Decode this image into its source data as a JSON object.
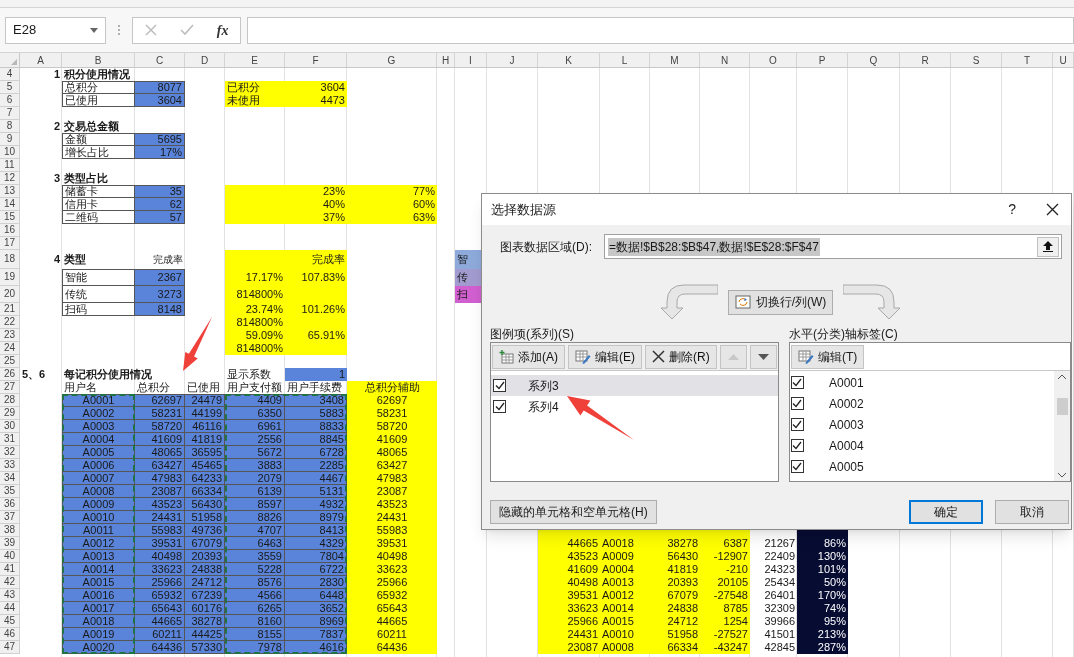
{
  "name_box": {
    "value": "E28"
  },
  "formula_bar": {
    "buttons": [
      {
        "kind": "cancel",
        "disabled": true
      },
      {
        "kind": "enter",
        "disabled": true
      },
      {
        "kind": "function",
        "label": "fx",
        "disabled": false
      }
    ]
  },
  "columns": [
    "A",
    "B",
    "C",
    "D",
    "E",
    "F",
    "G",
    "H",
    "I",
    "J",
    "K",
    "L",
    "M",
    "N",
    "O",
    "P",
    "Q",
    "R",
    "S",
    "T",
    "U"
  ],
  "rows": [
    {
      "header": "4",
      "cells": [
        "1",
        "积分使用情况"
      ]
    },
    {
      "header": "5",
      "cells": [
        null,
        "总积分",
        "8077",
        null,
        "已积分",
        "3604"
      ]
    },
    {
      "header": "6",
      "cells": [
        null,
        "已使用",
        "3604",
        null,
        "未使用",
        "4473"
      ]
    },
    {
      "header": "7"
    },
    {
      "header": "8",
      "cells": [
        "2",
        "交易总金额"
      ]
    },
    {
      "header": "9",
      "cells": [
        null,
        "金额",
        "5695"
      ]
    },
    {
      "header": "10",
      "cells": [
        null,
        "增长占比",
        "17%"
      ]
    },
    {
      "header": "11"
    },
    {
      "header": "12",
      "cells": [
        "3",
        "类型占比"
      ]
    },
    {
      "header": "13",
      "cells": [
        null,
        "储蓄卡",
        "35",
        null,
        null,
        "23%",
        "77%"
      ]
    },
    {
      "header": "14",
      "cells": [
        null,
        "信用卡",
        "62",
        null,
        null,
        "40%",
        "60%"
      ]
    },
    {
      "header": "15",
      "cells": [
        null,
        "二维码",
        "57",
        null,
        null,
        "37%",
        "63%"
      ]
    },
    {
      "header": "16"
    },
    {
      "header": "17"
    },
    {
      "header": "18",
      "cells": [
        "4",
        "类型",
        "完成率",
        null,
        null,
        "完成率",
        null,
        null,
        {
          "text": "智",
          "color": "#8eaadb"
        }
      ]
    },
    {
      "header": "19",
      "cells": [
        null,
        "智能",
        "2367",
        null,
        "17.17%",
        "107.83%",
        null,
        null,
        {
          "text": "传",
          "color": "#a29bcf"
        }
      ]
    },
    {
      "header": "20",
      "cells": [
        null,
        "传统",
        "3273",
        null,
        "814800%",
        null,
        null,
        null,
        {
          "text": "扫",
          "color": "#d25fd0"
        }
      ]
    },
    {
      "header": "21",
      "cells": [
        null,
        "扫码",
        "8148",
        null,
        "23.74%",
        "101.26%"
      ]
    },
    {
      "header": "22",
      "cells": [
        null,
        null,
        null,
        null,
        "814800%"
      ]
    },
    {
      "header": "23",
      "cells": [
        null,
        null,
        null,
        null,
        "59.09%",
        "65.91%"
      ]
    },
    {
      "header": "24",
      "cells": [
        null,
        null,
        null,
        null,
        "814800%"
      ]
    },
    {
      "header": "25"
    },
    {
      "header": "26",
      "cells": [
        "5、6",
        "每记积分使用情况",
        null,
        null,
        "显示系数",
        "1"
      ]
    },
    {
      "header": "27",
      "cells": [
        null,
        "用户名",
        "总积分",
        "已使用",
        "用户支付额",
        "用户手续费",
        "总积分辅助"
      ]
    },
    {
      "header": "28",
      "cells": [
        null,
        "A0001",
        "62697",
        "24479",
        "4409",
        "3408",
        "62697"
      ]
    },
    {
      "header": "29",
      "cells": [
        null,
        "A0002",
        "58231",
        "44199",
        "6350",
        "5883",
        "58231"
      ]
    },
    {
      "header": "30",
      "cells": [
        null,
        "A0003",
        "58720",
        "46116",
        "6961",
        "8833",
        "58720"
      ]
    },
    {
      "header": "31",
      "cells": [
        null,
        "A0004",
        "41609",
        "41819",
        "2556",
        "8845",
        "41609"
      ]
    },
    {
      "header": "32",
      "cells": [
        null,
        "A0005",
        "48065",
        "36595",
        "5672",
        "6728",
        "48065"
      ]
    },
    {
      "header": "33",
      "cells": [
        null,
        "A0006",
        "63427",
        "45465",
        "3883",
        "2285",
        "63427"
      ]
    },
    {
      "header": "34",
      "cells": [
        null,
        "A0007",
        "47983",
        "64233",
        "2079",
        "4467",
        "47983"
      ]
    },
    {
      "header": "35",
      "cells": [
        null,
        "A0008",
        "23087",
        "66334",
        "6139",
        "5131",
        "23087"
      ]
    },
    {
      "header": "36",
      "cells": [
        null,
        "A0009",
        "43523",
        "56430",
        "8597",
        "4932",
        "43523"
      ]
    },
    {
      "header": "37",
      "cells": [
        null,
        "A0010",
        "24431",
        "51958",
        "8826",
        "8979",
        "24431"
      ]
    },
    {
      "header": "38",
      "cells": [
        null,
        "A0011",
        "55983",
        "49736",
        "4707",
        "8413",
        "55983"
      ]
    },
    {
      "header": "39",
      "cells": [
        null,
        "A0012",
        "39531",
        "67079",
        "6463",
        "4329",
        "39531",
        null,
        null,
        null,
        "44665",
        "A0018",
        "38278",
        "6387",
        "21267",
        "86%"
      ]
    },
    {
      "header": "40",
      "cells": [
        null,
        "A0013",
        "40498",
        "20393",
        "3559",
        "7804",
        "40498",
        null,
        null,
        null,
        "43523",
        "A0009",
        "56430",
        "-12907",
        "22409",
        "130%"
      ]
    },
    {
      "header": "41",
      "cells": [
        null,
        "A0014",
        "33623",
        "24838",
        "5228",
        "6722",
        "33623",
        null,
        null,
        null,
        "41609",
        "A0004",
        "41819",
        "-210",
        "24323",
        "101%"
      ]
    },
    {
      "header": "42",
      "cells": [
        null,
        "A0015",
        "25966",
        "24712",
        "8576",
        "2830",
        "25966",
        null,
        null,
        null,
        "40498",
        "A0013",
        "20393",
        "20105",
        "25434",
        "50%"
      ]
    },
    {
      "header": "43",
      "cells": [
        null,
        "A0016",
        "65932",
        "67239",
        "4566",
        "6448",
        "65932",
        null,
        null,
        null,
        "39531",
        "A0012",
        "67079",
        "-27548",
        "26401",
        "170%"
      ]
    },
    {
      "header": "44",
      "cells": [
        null,
        "A0017",
        "65643",
        "60176",
        "6265",
        "3652",
        "65643",
        null,
        null,
        null,
        "33623",
        "A0014",
        "24838",
        "8785",
        "32309",
        "74%"
      ]
    },
    {
      "header": "45",
      "cells": [
        null,
        "A0018",
        "44665",
        "38278",
        "8160",
        "8969",
        "44665",
        null,
        null,
        null,
        "25966",
        "A0015",
        "24712",
        "1254",
        "39966",
        "95%"
      ]
    },
    {
      "header": "46",
      "cells": [
        null,
        "A0019",
        "60211",
        "44425",
        "8155",
        "7837",
        "60211",
        null,
        null,
        null,
        "24431",
        "A0010",
        "51958",
        "-27527",
        "41501",
        "213%"
      ]
    },
    {
      "header": "47",
      "cells": [
        null,
        "A0020",
        "64436",
        "57330",
        "7978",
        "4616",
        "64436",
        null,
        null,
        null,
        "23087",
        "A0008",
        "66334",
        "-43247",
        "42845",
        "287%"
      ]
    }
  ],
  "dialog": {
    "title": "选择数据源",
    "help": "?",
    "data_range": {
      "label": "图表数据区域(D):",
      "value": "=数据!$B$28:$B$47,数据!$E$28:$F$47",
      "selected": true
    },
    "switch_button": "切换行/列(W)",
    "series": {
      "label": "图例项(系列)(S)",
      "toolbar": [
        {
          "kind": "add",
          "label": "添加(A)",
          "disabled": false
        },
        {
          "kind": "edit",
          "label": "编辑(E)",
          "disabled": false
        },
        {
          "kind": "delete",
          "label": "删除(R)",
          "disabled": false
        },
        {
          "kind": "up",
          "disabled": true
        },
        {
          "kind": "down",
          "disabled": false
        }
      ],
      "items": [
        {
          "label": "系列3",
          "checked": true,
          "selected": true
        },
        {
          "label": "系列4",
          "checked": true,
          "selected": false
        }
      ]
    },
    "categories": {
      "label": "水平(分类)轴标签(C)",
      "edit_button": "编辑(T)",
      "items": [
        {
          "label": "A0001",
          "checked": true
        },
        {
          "label": "A0002",
          "checked": true
        },
        {
          "label": "A0003",
          "checked": true
        },
        {
          "label": "A0004",
          "checked": true
        },
        {
          "label": "A0005",
          "checked": true
        }
      ]
    },
    "hidden_cells_button": "隐藏的单元格和空单元格(H)",
    "ok_button": "确定",
    "cancel_button": "取消"
  }
}
